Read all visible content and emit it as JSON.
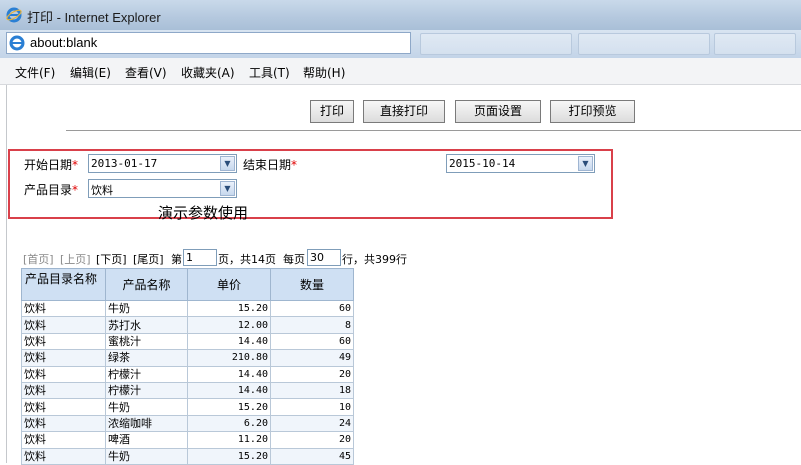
{
  "window": {
    "title": "打印 - Internet Explorer",
    "address": "about:blank"
  },
  "menu": [
    "文件(F)",
    "编辑(E)",
    "查看(V)",
    "收藏夹(A)",
    "工具(T)",
    "帮助(H)"
  ],
  "toolbar": {
    "print": "打印",
    "direct_print": "直接打印",
    "page_setup": "页面设置",
    "print_preview": "打印预览"
  },
  "params": {
    "start_date_label": "开始日期",
    "start_date": "2013-01-17",
    "end_date_label": "结束日期",
    "end_date": "2015-10-14",
    "category_label": "产品目录",
    "category": "饮料",
    "required_mark": "*",
    "note": "演示参数使用"
  },
  "pager": {
    "first": "[首页]",
    "prev": "[上页]",
    "next": "[下页]",
    "last": "[尾页]",
    "page_prefix": "第",
    "page": "1",
    "page_suffix": "页，共14页",
    "per_prefix": "每页",
    "per_page": "30",
    "per_suffix": "行，共399行"
  },
  "table": {
    "headers": [
      "产品目录名称",
      "产品名称",
      "单价",
      "数量"
    ],
    "rows": [
      [
        "饮料",
        "牛奶",
        "15.20",
        "60"
      ],
      [
        "饮料",
        "苏打水",
        "12.00",
        "8"
      ],
      [
        "饮料",
        "蜜桃汁",
        "14.40",
        "60"
      ],
      [
        "饮料",
        "绿茶",
        "210.80",
        "49"
      ],
      [
        "饮料",
        "柠檬汁",
        "14.40",
        "20"
      ],
      [
        "饮料",
        "柠檬汁",
        "14.40",
        "18"
      ],
      [
        "饮料",
        "牛奶",
        "15.20",
        "10"
      ],
      [
        "饮料",
        "浓缩咖啡",
        "6.20",
        "24"
      ],
      [
        "饮料",
        "啤酒",
        "11.20",
        "20"
      ],
      [
        "饮料",
        "牛奶",
        "15.20",
        "45"
      ]
    ]
  },
  "colors": {
    "highlight_border": "#d9404a",
    "required": "#e00000",
    "header_bg": "#cfe0f3"
  }
}
